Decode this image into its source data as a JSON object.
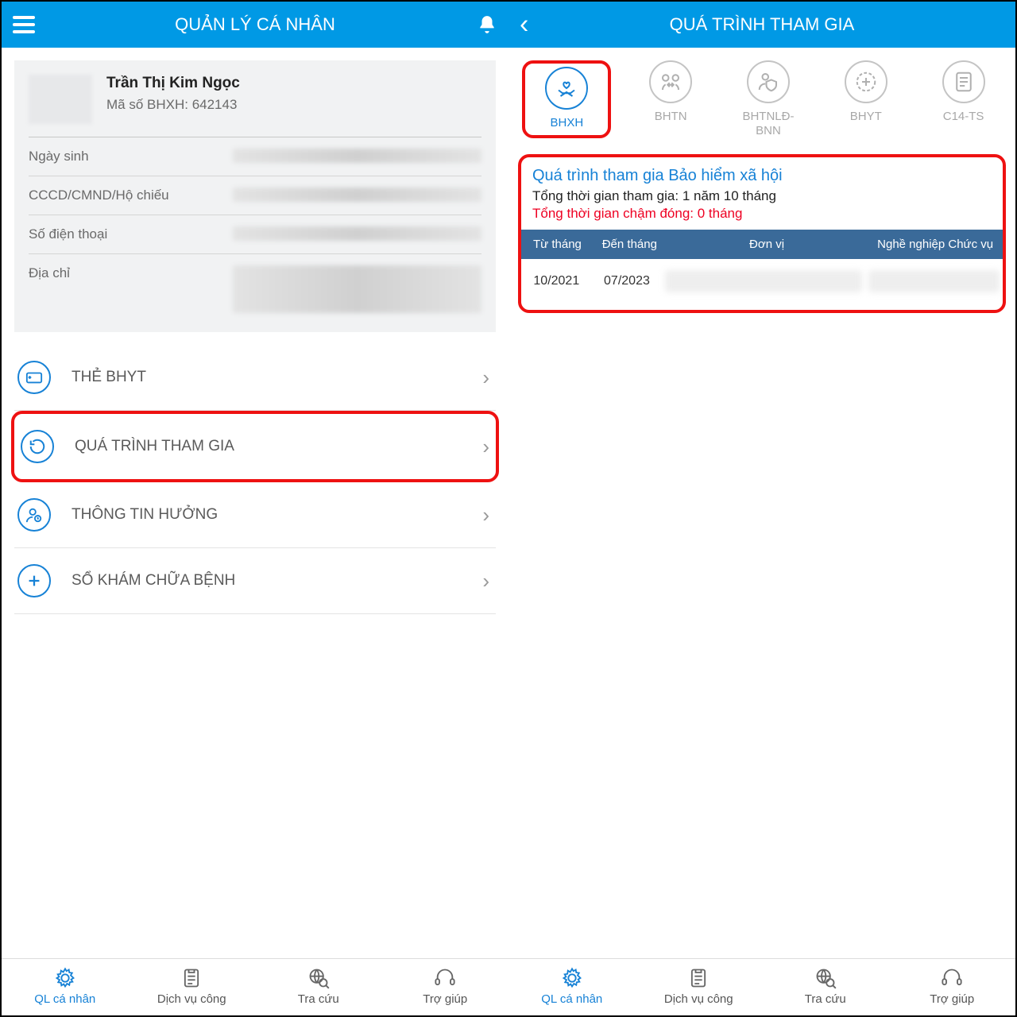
{
  "left": {
    "header_title": "QUẢN LÝ CÁ NHÂN",
    "user_name": "Trần Thị Kim Ngọc",
    "bhxh_label": "Mã số BHXH: 642143",
    "rows": {
      "dob": "Ngày sinh",
      "id": "CCCD/CMND/Hộ chiếu",
      "phone": "Số điện thoại",
      "addr": "Địa chỉ"
    },
    "menu": {
      "bhyt": "THẺ BHYT",
      "process": "QUÁ TRÌNH THAM GIA",
      "benefit": "THÔNG TIN HƯỞNG",
      "medical": "SỔ KHÁM CHỮA BỆNH"
    }
  },
  "right": {
    "header_title": "QUÁ TRÌNH THAM GIA",
    "tabs": {
      "bhxh": "BHXH",
      "bhtn": "BHTN",
      "bhtnld": "BHTNLĐ-BNN",
      "bhyt": "BHYT",
      "c14": "C14-TS"
    },
    "panel": {
      "title": "Quá trình tham gia Bảo hiểm xã hội",
      "total_label": "Tổng thời gian tham gia: ",
      "total_value": "1 năm 10 tháng",
      "late_label": "Tổng thời gian chậm đóng: ",
      "late_value": "0 tháng",
      "cols": {
        "c1": "Từ tháng",
        "c2": "Đến tháng",
        "c3": "Đơn vị",
        "c4": "Nghề nghiệp Chức vụ"
      },
      "row": {
        "from": "10/2021",
        "to": "07/2023"
      }
    }
  },
  "bottom": {
    "a": "QL cá nhân",
    "b": "Dịch vụ công",
    "c": "Tra cứu",
    "d": "Trợ giúp"
  }
}
